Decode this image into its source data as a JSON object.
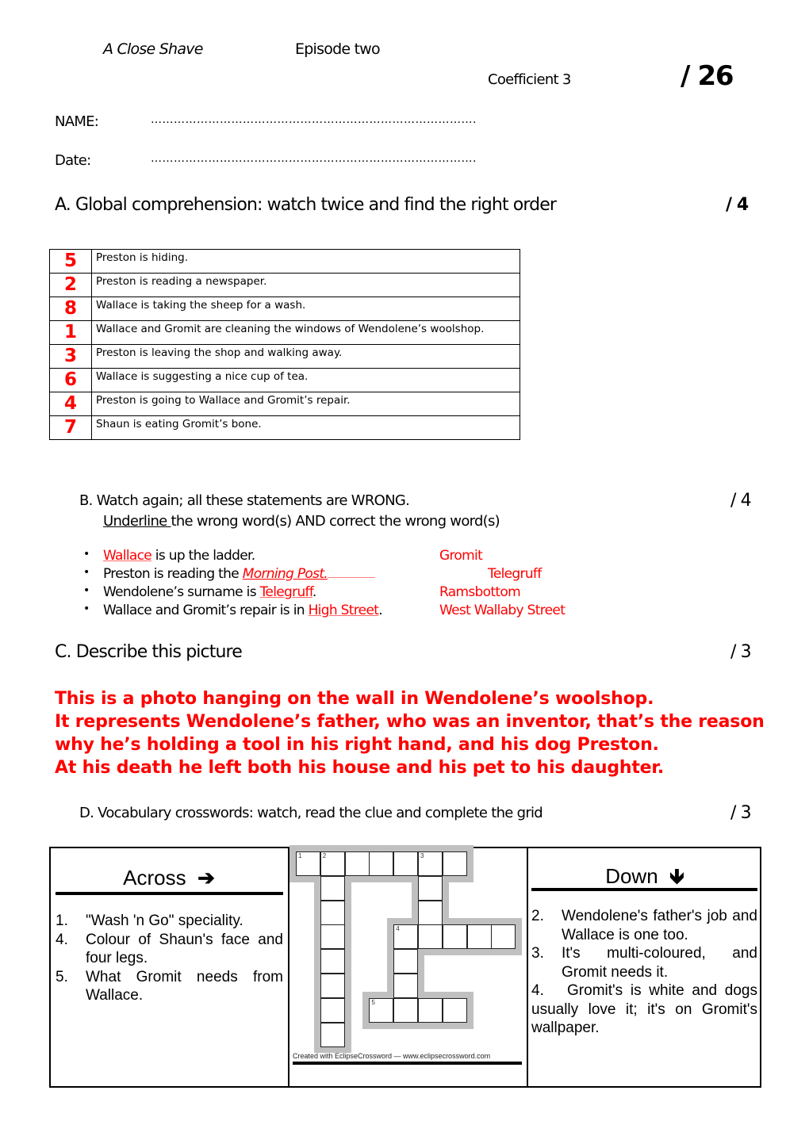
{
  "header": {
    "title": "A Close Shave",
    "episode": "Episode two",
    "coefficient": "Coefficient 3",
    "total_score": "/ 26",
    "name_label": "NAME:",
    "name_dots": "………………………………………………………………………….",
    "date_label": "Date:",
    "date_dots": "………………………………………………………………………….",
    "accent_color": "#ff0000"
  },
  "section_a": {
    "title": "A. Global comprehension: watch twice and find the right order",
    "score": "/ 4",
    "rows": [
      {
        "order": "5",
        "text": "Preston is hiding."
      },
      {
        "order": "2",
        "text": "Preston is reading a newspaper."
      },
      {
        "order": "8",
        "text": "Wallace is taking the sheep for a wash."
      },
      {
        "order": "1",
        "text": "Wallace and Gromit are cleaning the windows of Wendolene’s woolshop."
      },
      {
        "order": "3",
        "text": "Preston is leaving the shop and walking away."
      },
      {
        "order": "6",
        "text": "Wallace is suggesting a nice cup of tea."
      },
      {
        "order": "4",
        "text": "Preston is going to Wallace and Gromit’s repair."
      },
      {
        "order": "7",
        "text": "Shaun is eating Gromit’s bone."
      }
    ]
  },
  "section_b": {
    "title": "B.  Watch again; all these statements are WRONG.",
    "score": "/ 4",
    "instruction_underlined": "Underline ",
    "instruction_rest": "the wrong word(s) AND correct the wrong word(s)",
    "bullet": "•",
    "items": [
      {
        "before": "",
        "wrong": "Wallace",
        "after": " is up the ladder.",
        "correction": "Gromit"
      },
      {
        "before": "Preston is reading the ",
        "wrong": "Morning Post.",
        "after": "",
        "correction": "Telegruff"
      },
      {
        "before": "Wendolene’s surname is ",
        "wrong": "Telegruff",
        "after": ".",
        "correction": "Ramsbottom"
      },
      {
        "before": "Wallace and Gromit’s repair is in ",
        "wrong": "High Street",
        "after": ".",
        "correction": "West Wallaby Street"
      }
    ]
  },
  "section_c": {
    "title": "C.  Describe this picture",
    "score": "/ 3",
    "answer_lines": [
      "This is a photo hanging on the wall in Wendolene’s woolshop.",
      "It represents Wendolene’s father, who was an inventor, that’s the reason",
      "why he’s holding a tool in his right hand, and his dog Preston.",
      "At his death he left both his house and his pet to his daughter."
    ]
  },
  "section_d": {
    "title": "D.  Vocabulary crosswords: watch, read the clue and complete the grid",
    "score": "/ 3",
    "across": {
      "heading": "Across",
      "arrow_icon": "➔",
      "clues": [
        {
          "num": "1.",
          "text": "\"Wash 'n Go\" speciality."
        },
        {
          "num": "4.",
          "text": "Colour of Shaun's face and four legs."
        },
        {
          "num": "5.",
          "text": "What Gromit needs from Wallace."
        }
      ]
    },
    "down": {
      "heading": "Down",
      "arrow_icon": "🡻",
      "clues": [
        {
          "num": "2.",
          "text": "Wendolene's father's job and Wallace is one too."
        },
        {
          "num": "3.",
          "text": "It's multi-coloured, and Gromit needs it."
        },
        {
          "num": "4.",
          "text": "Gromit's is white and dogs usually love it; it's on Gromit's wallpaper."
        }
      ]
    },
    "grid": {
      "entries": [
        {
          "number": "1",
          "direction": "across",
          "row": 0,
          "col": 0,
          "length": 7
        },
        {
          "number": "2",
          "direction": "down",
          "row": 0,
          "col": 1,
          "length": 8
        },
        {
          "number": "3",
          "direction": "down",
          "row": 0,
          "col": 5,
          "length": 3
        },
        {
          "number": "4",
          "direction": "across",
          "row": 3,
          "col": 4,
          "length": 5
        },
        {
          "number": "4",
          "direction": "down",
          "row": 3,
          "col": 4,
          "length": 3
        },
        {
          "number": "5",
          "direction": "across",
          "row": 6,
          "col": 3,
          "length": 4
        }
      ]
    },
    "credit": "Created with EclipseCrossword — www.eclipsecrossword.com"
  }
}
